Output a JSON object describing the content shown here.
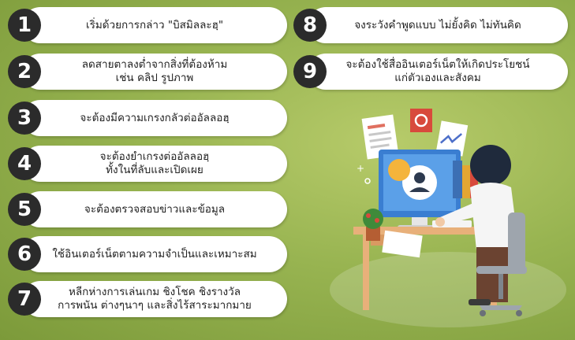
{
  "items": [
    {
      "num": "1",
      "lines": [
        "เริ่มด้วยการกล่าว \"บิสมิลละฮฺ\""
      ]
    },
    {
      "num": "2",
      "lines": [
        "ลดสายตาลงต่ำจากสิ่งที่ต้องห้าม",
        "เช่น คลิป รูปภาพ"
      ]
    },
    {
      "num": "3",
      "lines": [
        "จะต้องมีความเกรงกลัวต่ออัลลอฮฺ"
      ]
    },
    {
      "num": "4",
      "lines": [
        "จะต้องยำเกรงต่ออัลลอฮฺ",
        "ทั้งในที่ลับและเปิดเผย"
      ]
    },
    {
      "num": "5",
      "lines": [
        "จะต้องตรวจสอบข่าวและข้อมูล"
      ]
    },
    {
      "num": "6",
      "lines": [
        "ใช้อินเตอร์เน็ตตามความจำเป็นและเหมาะสม"
      ]
    },
    {
      "num": "7",
      "lines": [
        "หลีกห่างการเล่นเกม ชิงโชค ชิงรางวัล",
        "การพนัน ต่างๆนาๆ และสิ่งไร้สาระมากมาย"
      ]
    },
    {
      "num": "8",
      "lines": [
        "จงระวังคำพูดแบบ ไม่ยั้งคิด ไม่ทันคิด"
      ]
    },
    {
      "num": "9",
      "lines": [
        "จะต้องใช้สื่ออินเตอร์เน็ตให้เกิดประโยชน์",
        "แก่ตัวเองและสังคม"
      ]
    }
  ],
  "colors": {
    "badge": "#2b2b2b",
    "pill": "#ffffff",
    "background": "#98b451"
  },
  "illustration": {
    "icons": [
      "person-at-computer-icon",
      "user-avatar-icon",
      "document-icon",
      "chart-icon",
      "plant-icon",
      "chair-icon"
    ]
  }
}
